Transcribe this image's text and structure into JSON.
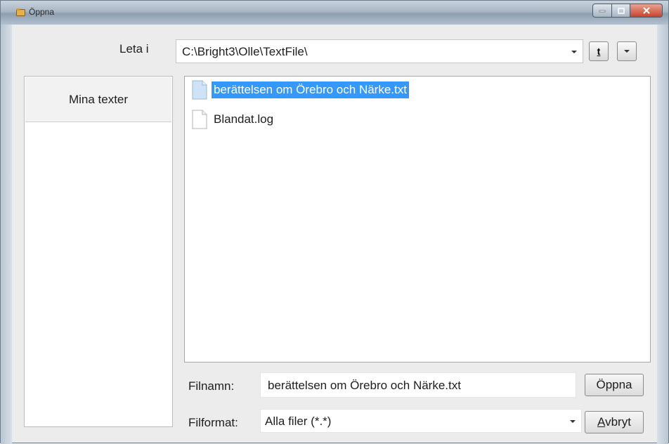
{
  "window": {
    "title": "Öppna",
    "controls": {
      "minimize_icon": "minimize-icon",
      "maximize_icon": "maximize-icon",
      "close_icon": "close-icon"
    }
  },
  "toolbar": {
    "look_in_label": "Leta i",
    "path": "C:\\Bright3\\Olle\\TextFile\\",
    "up_button_glyph": "t",
    "views_icon": "chevron-down-icon"
  },
  "places": {
    "items": [
      {
        "label": "Mina texter"
      }
    ]
  },
  "files": [
    {
      "name": "berättelsen om Örebro och Närke.txt",
      "selected": true
    },
    {
      "name": "Blandat.log",
      "selected": false
    }
  ],
  "footer": {
    "filename_label": "Filnamn:",
    "filename_value": "berättelsen om Örebro och Närke.txt",
    "filetype_label": "Filformat:",
    "filetype_value": "Alla filer (*.*)",
    "open_label": "Öppna",
    "cancel_label_first": "A",
    "cancel_label_rest": "vbryt"
  },
  "colors": {
    "selection": "#3399ff",
    "close_button": "#c8442a"
  }
}
